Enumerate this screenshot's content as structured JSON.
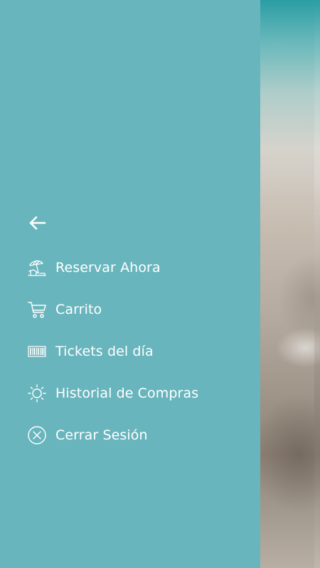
{
  "drawer": {
    "background_color": "#69b5bd",
    "text_color": "#ffffff",
    "back_icon": "arrow-left-icon",
    "items": [
      {
        "label": "Reservar Ahora",
        "icon": "beach-umbrella-icon"
      },
      {
        "label": "Carrito",
        "icon": "cart-icon"
      },
      {
        "label": "Tickets del día",
        "icon": "barcode-icon"
      },
      {
        "label": "Historial de Compras",
        "icon": "sun-icon"
      },
      {
        "label": "Cerrar Sesión",
        "icon": "close-circle-icon"
      }
    ]
  }
}
